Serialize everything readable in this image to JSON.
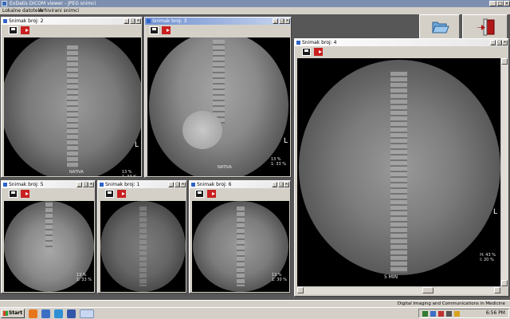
{
  "app": {
    "title": "ExDatis DICOM viewer - JPEG snimci",
    "menu": [
      "Lokalne datoteke",
      "Arhivirani snimci"
    ]
  },
  "windows": [
    {
      "title": "Snimak broj: 2",
      "overlay": "13 %\n1: 33 %",
      "tag": "NATIVA"
    },
    {
      "title": "Snimak broj: 3",
      "overlay": "13 %\n1: 33 %",
      "tag": "NATIVA"
    },
    {
      "title": "Snimak broj: 4",
      "overlay": "H: 43 %\nI: 20 %",
      "tag": "5 MIN",
      "orientation": "L"
    },
    {
      "title": "Snimak broj: 5",
      "overlay": "13 %\n1: 33 %"
    },
    {
      "title": "Snimak broj: 1",
      "overlay": ""
    },
    {
      "title": "Snimak broj: 6",
      "overlay": "13 %\n1: 30 %"
    }
  ],
  "orientation_marker": "L",
  "toolbar_icons": [
    "open-folder-icon",
    "exit-door-icon"
  ],
  "status": {
    "text": "Digital Imaging and Communications in Medicine"
  },
  "taskbar": {
    "start": "Start",
    "clock": "6:56 PM"
  },
  "colors": {
    "title_active": "#6f8fd0",
    "workspace": "#575757",
    "chrome": "#d4d0c8"
  }
}
